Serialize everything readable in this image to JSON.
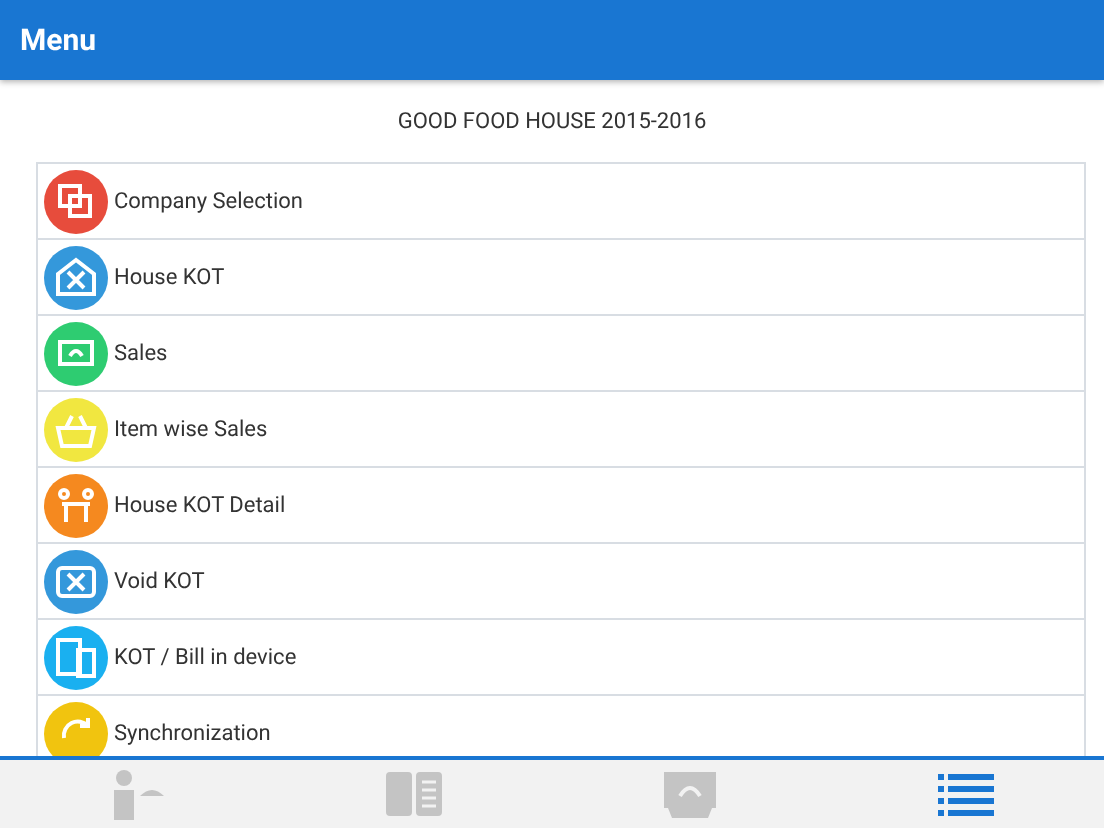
{
  "header": {
    "title": "Menu"
  },
  "subtitle": "GOOD FOOD HOUSE 2015-2016",
  "menu_items": [
    {
      "label": "Company Selection",
      "kind": "copy",
      "color": "#e74c3c"
    },
    {
      "label": "House KOT",
      "kind": "house",
      "color": "#3498db"
    },
    {
      "label": "Sales",
      "kind": "money",
      "color": "#2ecc71"
    },
    {
      "label": "Item wise Sales",
      "kind": "basket",
      "color": "#f1e740"
    },
    {
      "label": "House KOT Detail",
      "kind": "table",
      "color": "#f5891f"
    },
    {
      "label": "Void KOT",
      "kind": "cutlery",
      "color": "#3498db"
    },
    {
      "label": "KOT / Bill in device",
      "kind": "devices",
      "color": "#1ab0f0"
    },
    {
      "label": "Synchronization",
      "kind": "sync",
      "color": "#f1c40f"
    }
  ],
  "tabs": [
    {
      "kind": "waiter",
      "selected": false
    },
    {
      "kind": "menu-book",
      "selected": false
    },
    {
      "kind": "money",
      "selected": false
    },
    {
      "kind": "list",
      "selected": true
    }
  ]
}
